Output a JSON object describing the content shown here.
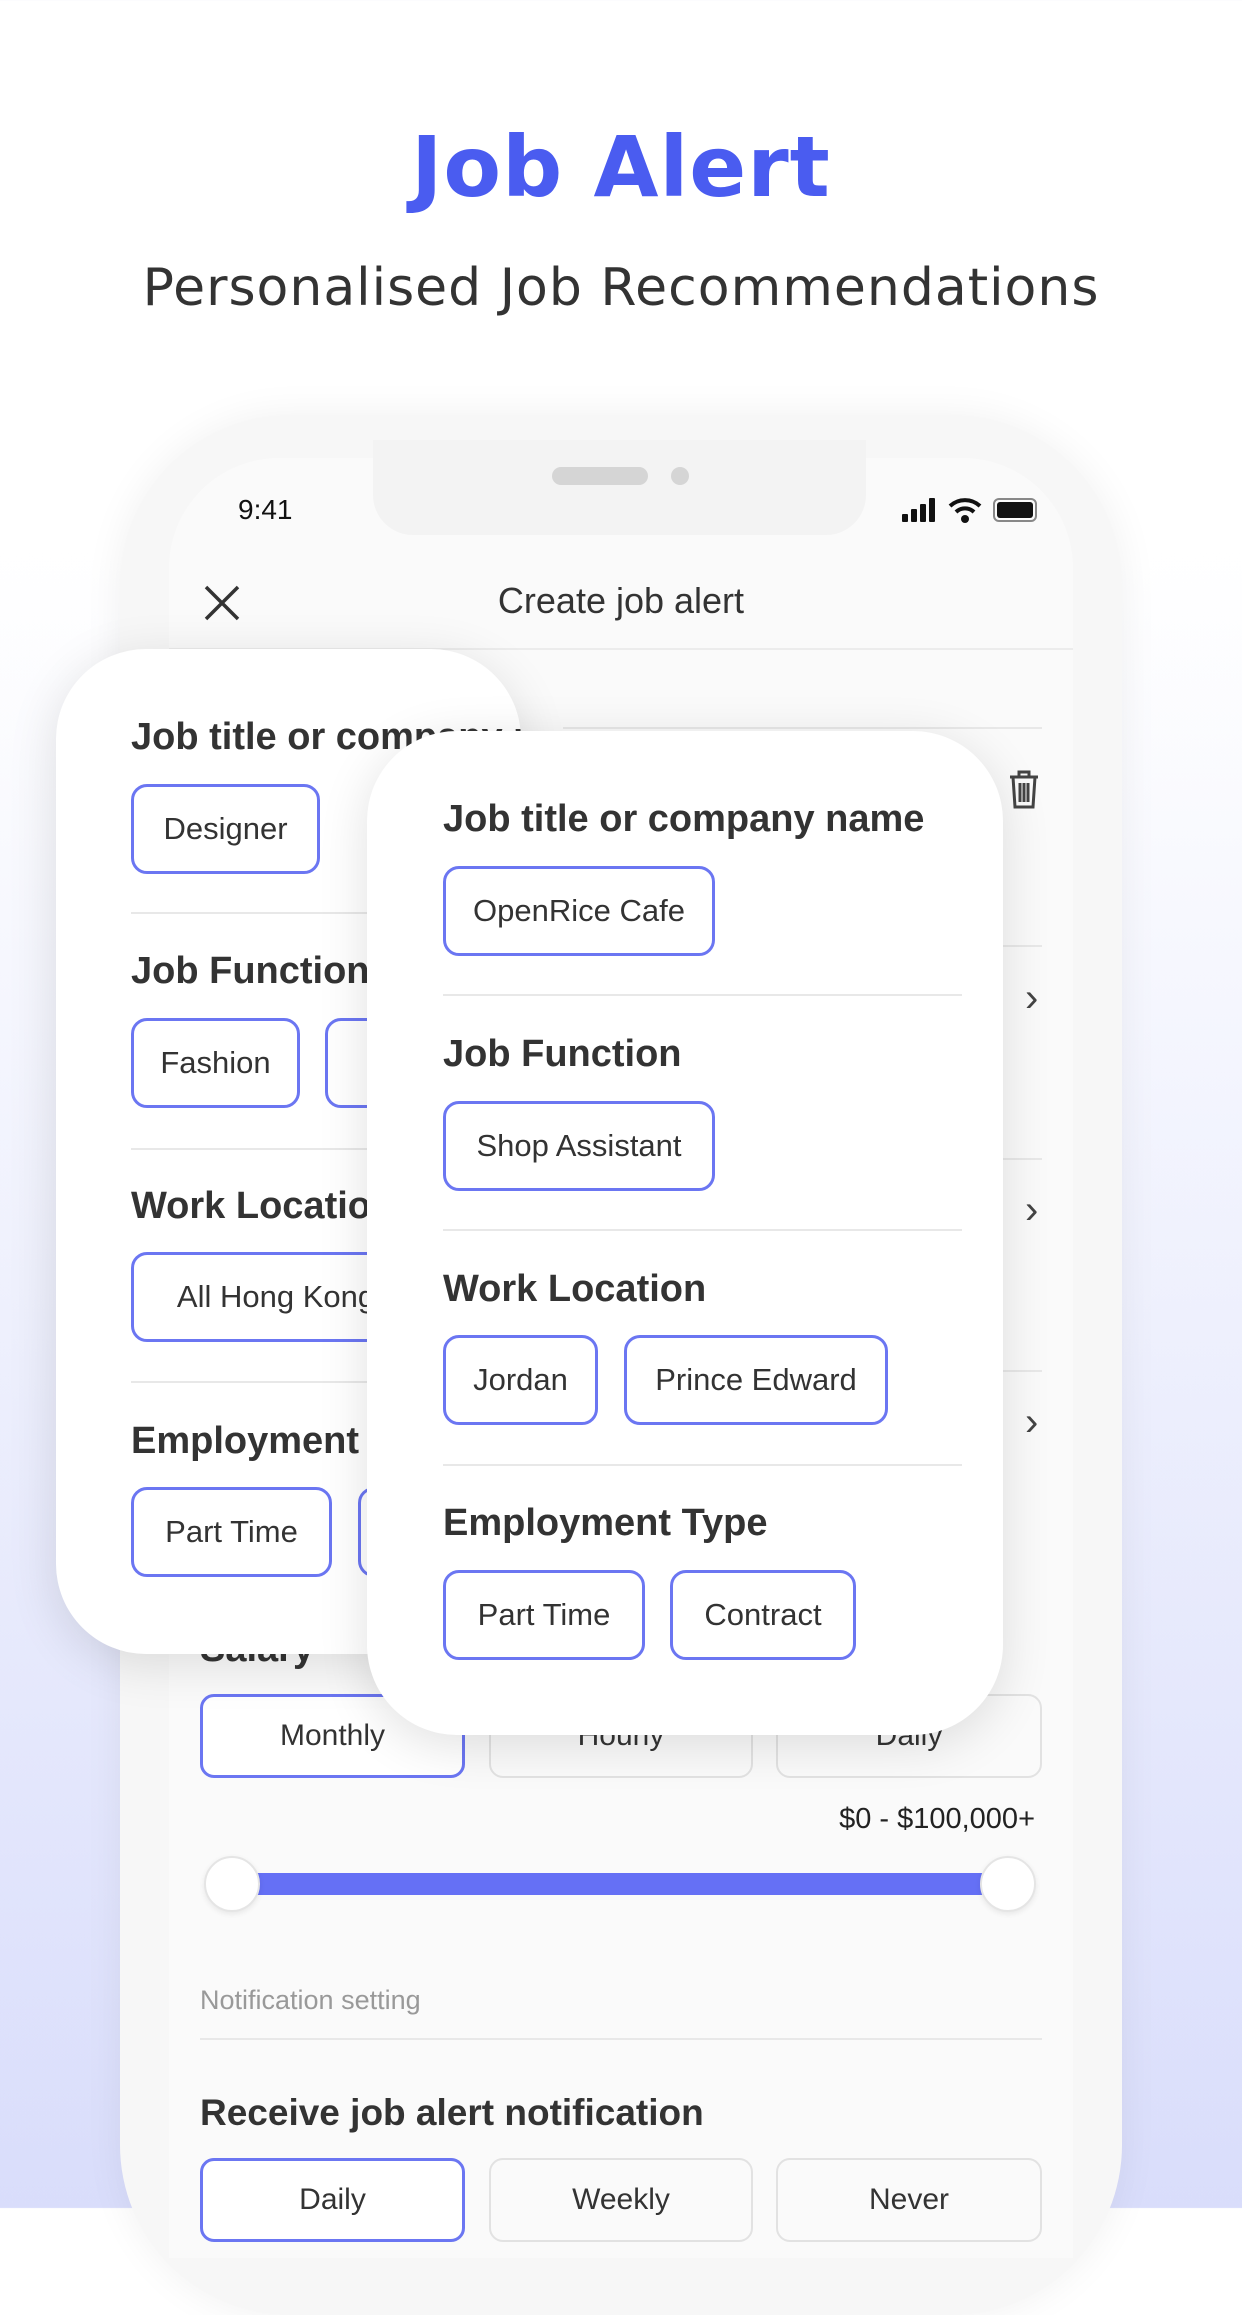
{
  "promo": {
    "title": "Job Alert",
    "subtitle": "Personalised Job Recommendations",
    "accent": "#4a5cf0"
  },
  "status_bar": {
    "time": "9:41",
    "icons": [
      "signal-icon",
      "wifi-icon",
      "battery-icon"
    ]
  },
  "header": {
    "title": "Create job alert",
    "close_icon": "close-icon"
  },
  "background_form": {
    "salary_label": "Salary",
    "salary_periods": [
      {
        "label": "Monthly",
        "selected": true
      },
      {
        "label": "Hourly",
        "selected": false
      },
      {
        "label": "Daily",
        "selected": false
      }
    ],
    "salary_range": "$0 - $100,000+",
    "slider": {
      "min_percent": 0,
      "max_percent": 100
    },
    "notification_section": "Notification setting",
    "receive_label": "Receive job alert notification",
    "frequencies": [
      {
        "label": "Daily",
        "selected": true
      },
      {
        "label": "Weekly",
        "selected": false
      },
      {
        "label": "Never",
        "selected": false
      }
    ]
  },
  "card_back": {
    "sections": [
      {
        "label": "Job title or company name",
        "chips": [
          "Designer"
        ]
      },
      {
        "label": "Job Function",
        "chips": [
          "Fashion",
          ""
        ]
      },
      {
        "label": "Work Location",
        "chips": [
          "All Hong Kong"
        ]
      },
      {
        "label": "Employment Type",
        "chips": [
          "Part Time",
          ""
        ]
      }
    ]
  },
  "card_front": {
    "sections": [
      {
        "label": "Job title or company name",
        "chips": [
          "OpenRice Cafe"
        ]
      },
      {
        "label": "Job Function",
        "chips": [
          "Shop Assistant"
        ]
      },
      {
        "label": "Work Location",
        "chips": [
          "Jordan",
          "Prince Edward"
        ]
      },
      {
        "label": "Employment Type",
        "chips": [
          "Part Time",
          "Contract"
        ]
      }
    ]
  },
  "colors": {
    "chip_border": "#6b76f2",
    "slider": "#6570f5"
  }
}
